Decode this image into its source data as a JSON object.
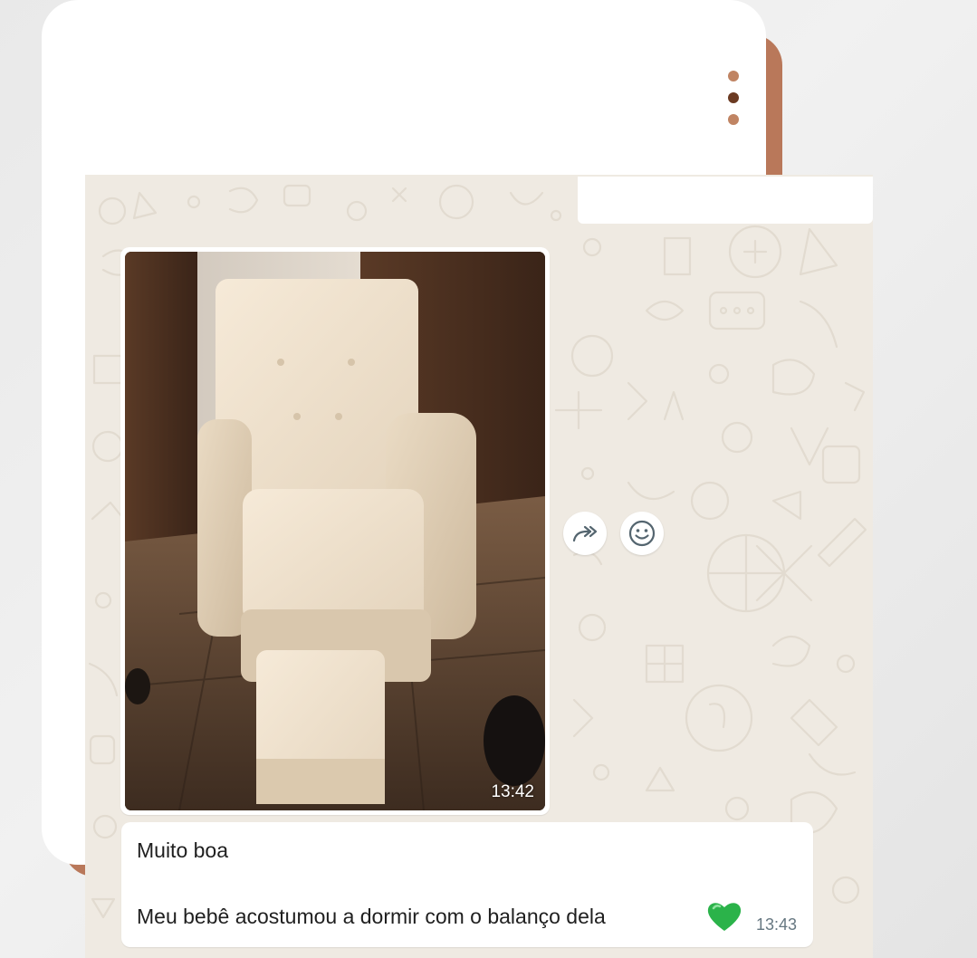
{
  "header": {
    "menu_icon": "vertical-dots-icon",
    "dot_colors": [
      "#c08463",
      "#6b3a22",
      "#c08463"
    ]
  },
  "colors": {
    "accent": "#b9785a",
    "chat_background": "#efeae2",
    "bubble": "#ffffff",
    "heart": "#2bb34a",
    "timestamp": "#667781"
  },
  "messages": [
    {
      "type": "image",
      "description": "cream tufted glider rocking chair with matching ottoman",
      "time": "13:42"
    },
    {
      "type": "text",
      "line1": "Muito boa",
      "line2": "Meu bebê acostumou a dormir com o balanço dela",
      "emoji": "green-heart",
      "time": "13:43"
    }
  ],
  "actions": {
    "forward_icon": "forward-icon",
    "react_icon": "smiley-icon"
  }
}
